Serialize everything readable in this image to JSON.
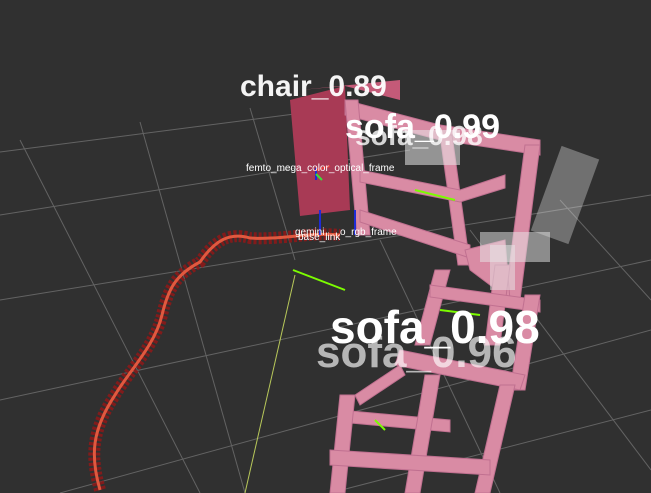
{
  "scene": {
    "background": "#303030",
    "grid_color": "#6c6c6c",
    "path_color": "#c0392b",
    "box_color": "#d98ba4",
    "box_dark": "#a83a55",
    "pointcloud_color": "#e8e8e8",
    "laser_color": "#7cfc00",
    "z_axis_color": "#1f2bd6"
  },
  "frames": {
    "camera": "femto_mega_color_optical_frame",
    "base": "base_link",
    "overlap_1": "gemini",
    "overlap_2": "o_rgb_frame"
  },
  "objects": {
    "sofa_upper_a": "sofa_0.99",
    "sofa_upper_b": "sofa_0.98",
    "sofa_lower_a": "sofa_0.98",
    "sofa_lower_b": "sofa_0.96",
    "top_cluster": "chair_0.89"
  }
}
